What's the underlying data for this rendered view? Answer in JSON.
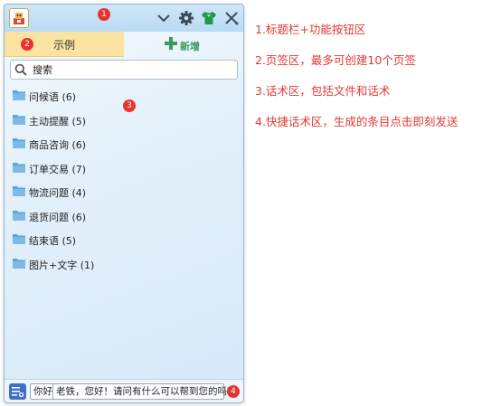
{
  "markers": {
    "title": "1",
    "tabs": "2",
    "content": "3",
    "quick": "4"
  },
  "titlebar": {
    "icons": [
      "app-logo-icon",
      "chevron-down-icon",
      "gear-icon",
      "shirt-skin-icon",
      "close-icon"
    ],
    "accent_color": "#b8dbf4"
  },
  "tabs": {
    "active_label": "示例",
    "add_label": "新增",
    "active_color": "#fbe3a2",
    "add_color": "#3a9a5a"
  },
  "search": {
    "placeholder": "搜索"
  },
  "folders": [
    {
      "label": "问候语 (6)"
    },
    {
      "label": "主动提醒 (5)"
    },
    {
      "label": "商品咨询 (6)"
    },
    {
      "label": "订单交易 (7)"
    },
    {
      "label": "物流问题 (4)"
    },
    {
      "label": "退货问题 (6)"
    },
    {
      "label": "结束语 (5)"
    },
    {
      "label": "图片+文字 (1)"
    }
  ],
  "folder_icon_color": "#5ba3d9",
  "quickbar": {
    "phrases": [
      "你好",
      "老铁，您好！请问有什么可以帮到您的吗？"
    ]
  },
  "annotations": [
    "1.标题栏+功能按钮区",
    "2.页签区，最多可创建10个页签",
    "3.话术区，包括文件和话术",
    "4.快捷话术区，生成的条目点击即刻发送"
  ],
  "annotation_color": "#e23a32",
  "marker_color": "#e8332f"
}
